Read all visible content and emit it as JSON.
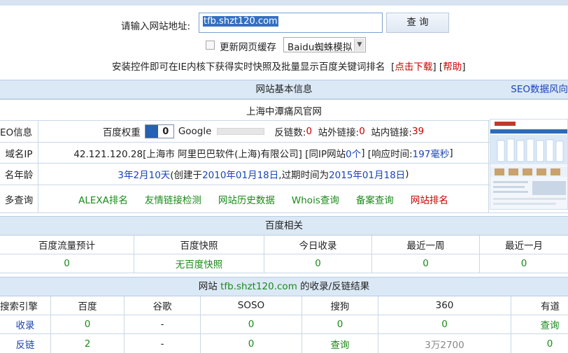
{
  "search": {
    "label": "请输入网站地址:",
    "url_value": "tfb.shzt120.com",
    "query_button": "查 询",
    "refresh_cache_label": "更新网页缓存",
    "spider_select": "Baidu蜘蛛模拟",
    "notice_text": "安装控件即可在IE内核下获得实时快照及批量显示百度关键词排名",
    "download_link": "点击下载",
    "help_link": "帮助"
  },
  "basic_info": {
    "title": "网站基本信息",
    "seo_trend_link": "SEO数据风向",
    "site_name": "上海中潭痛风官网",
    "seo_info_label": "EO信息",
    "baidu_weight_label": "百度权重",
    "baidu_weight_value": "0",
    "google_label": "Google",
    "backlinks_label": "反链数:",
    "backlinks_value": "0",
    "outbound_links_label": "站外链接:",
    "outbound_links_value": "0",
    "inbound_links_label": "站内链接:",
    "inbound_links_value": "39",
    "domain_ip_label": "域名IP",
    "ip_value": "42.121.120.28[上海市 阿里巴巴软件(上海)有限公司]",
    "same_ip_prefix": "[同IP网站",
    "same_ip_count": "0个",
    "same_ip_suffix": "]",
    "response_prefix": "[响应时间:",
    "response_value": "197毫秒",
    "response_suffix": "]",
    "domain_age_label": "名年龄",
    "age_value": "3年2月10天",
    "created_prefix": "(创建于",
    "created_value": "2010年01月18日",
    "expire_prefix": ",过期时间为",
    "expire_value": "2015年01月18日",
    "expire_suffix": ")",
    "more_query_label": "多查询",
    "more_links": [
      "ALEXA排名",
      "友情链接检测",
      "网站历史数据",
      "Whois查询",
      "备案查询",
      "网站排名"
    ]
  },
  "baidu": {
    "title": "百度相关",
    "headers": [
      "百度流量预计",
      "百度快照",
      "今日收录",
      "最近一周",
      "最近一月"
    ],
    "values": [
      "0",
      "无百度快照",
      "0",
      "0",
      "0"
    ]
  },
  "index_results": {
    "title_prefix": "网站",
    "title_domain": "tfb.shzt120.com",
    "title_suffix": "的收录/反链结果",
    "headers": [
      "搜索引擎",
      "百度",
      "谷歌",
      "SOSO",
      "搜狗",
      "360",
      "有道"
    ],
    "rows": [
      {
        "label": "收录",
        "values": [
          "0",
          "-",
          "0",
          "0",
          "0",
          "查询"
        ]
      },
      {
        "label": "反链",
        "values": [
          "2",
          "-",
          "0",
          "查询",
          "3万2700",
          "0"
        ]
      }
    ]
  }
}
